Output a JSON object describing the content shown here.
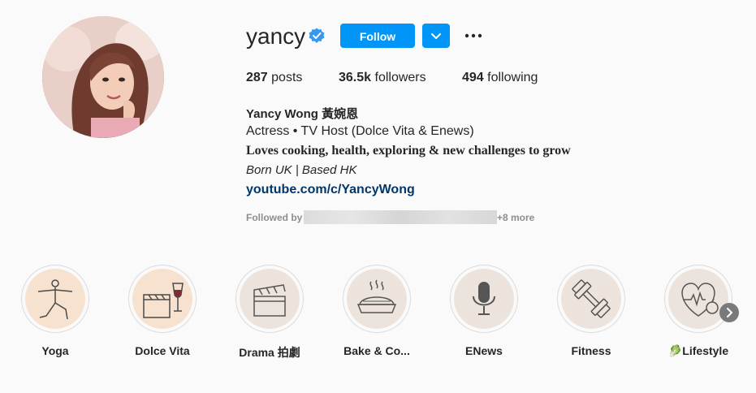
{
  "profile": {
    "username": "yancy",
    "follow_label": "Follow",
    "stats": {
      "posts_count": "287",
      "posts_label": "posts",
      "followers_count": "36.5k",
      "followers_label": "followers",
      "following_count": "494",
      "following_label": "following"
    },
    "full_name": "Yancy Wong 黃婉恩",
    "bio_line1": "Actress • TV Host (Dolce Vita & Enews)",
    "bio_line2": "Loves cooking, health, exploring & new challenges to grow",
    "bio_line3": "Born UK | Based HK",
    "link": "youtube.com/c/YancyWong",
    "followed_by_label": "Followed by",
    "followed_by_more": "+8 more"
  },
  "highlights": [
    {
      "label": "Yoga",
      "icon": "yoga-pose-icon",
      "bg": "#f7e2d0"
    },
    {
      "label": "Dolce Vita",
      "icon": "clapperboard-wine-icon",
      "bg": "#f7e2d0"
    },
    {
      "label": "Drama 拍劇",
      "icon": "clapperboard-icon",
      "bg": "#ece4dc"
    },
    {
      "label": "Bake & Co...",
      "icon": "pie-icon",
      "bg": "#ece4dc"
    },
    {
      "label": "ENews",
      "icon": "microphone-icon",
      "bg": "#ece4dc"
    },
    {
      "label": "Fitness",
      "icon": "dumbbell-icon",
      "bg": "#ece4dc"
    },
    {
      "label": "🥬Lifestyle",
      "icon": "heart-apple-icon",
      "bg": "#ece4dc"
    }
  ],
  "colors": {
    "accent": "#0095f6",
    "link": "#00376b",
    "verified": "#3897f0",
    "background": "#fafafa"
  }
}
